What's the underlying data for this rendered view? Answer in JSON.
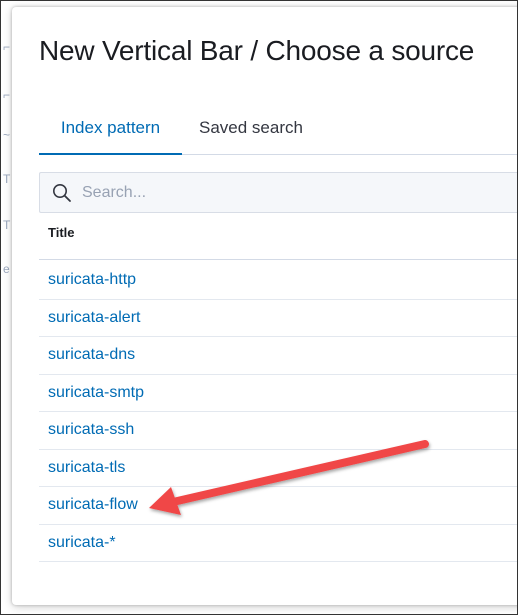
{
  "modal": {
    "title": "New Vertical Bar / Choose a source"
  },
  "tabs": [
    {
      "label": "Index pattern",
      "active": true
    },
    {
      "label": "Saved search",
      "active": false
    }
  ],
  "search": {
    "placeholder": "Search...",
    "value": ""
  },
  "table": {
    "column_header": "Title",
    "rows": [
      "suricata-http",
      "suricata-alert",
      "suricata-dns",
      "suricata-smtp",
      "suricata-ssh",
      "suricata-tls",
      "suricata-flow",
      "suricata-*"
    ]
  },
  "annotation": {
    "arrow_target": "suricata-flow",
    "arrow_color": "#f04646"
  },
  "colors": {
    "link": "#006bb4",
    "title_text": "#1a1c21",
    "border": "#d3dae6",
    "search_bg": "#f5f7fa"
  }
}
